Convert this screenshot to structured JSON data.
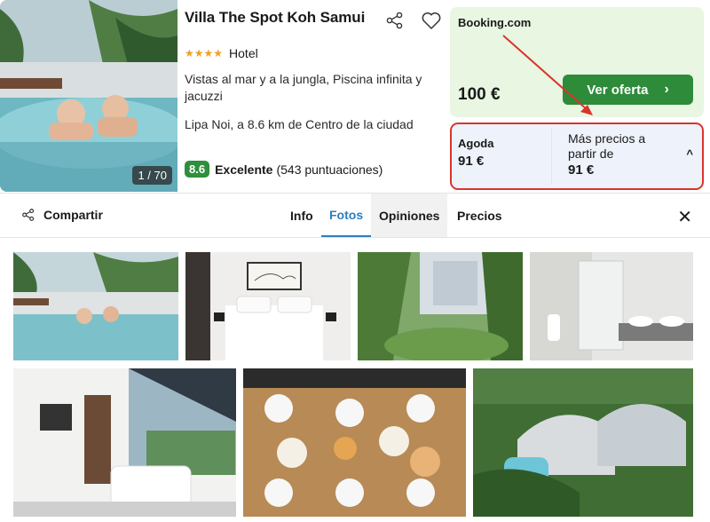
{
  "hotel": {
    "name": "Villa The Spot Koh Samui",
    "stars": "★★★★",
    "type": "Hotel",
    "description": "Vistas al mar y a la jungla, Piscina infinita y jacuzzi",
    "location": "Lipa Noi, a 8.6 km de Centro de la ciudad",
    "rating_score": "8.6",
    "rating_label": "Excelente",
    "rating_count": "(543 puntuaciones)",
    "photo_counter": "1 / 70"
  },
  "deal": {
    "provider": "Booking.com",
    "price": "100 €",
    "button_label": "Ver oferta",
    "chevron": "›"
  },
  "alternatives": {
    "provider": "Agoda",
    "provider_price": "91 €",
    "more_label": "Más precios a partir de",
    "more_price": "91 €",
    "chevron": "^"
  },
  "tabbar": {
    "share_label": "Compartir",
    "tabs": [
      {
        "label": "Info"
      },
      {
        "label": "Fotos"
      },
      {
        "label": "Opiniones"
      },
      {
        "label": "Precios"
      }
    ],
    "close": "✕"
  },
  "icons": {
    "share": "share-icon",
    "favorite": "heart-icon",
    "close": "close-icon",
    "chevron_right": "chevron-right-icon",
    "chevron_up": "chevron-up-icon"
  },
  "colors": {
    "accent_blue": "#2a7fc1",
    "deal_green": "#2e8b3a",
    "deal_bg": "#e8f6e2",
    "rating_green": "#2f8f3c",
    "highlight_red": "#d9352b",
    "stars": "#f0a020"
  }
}
